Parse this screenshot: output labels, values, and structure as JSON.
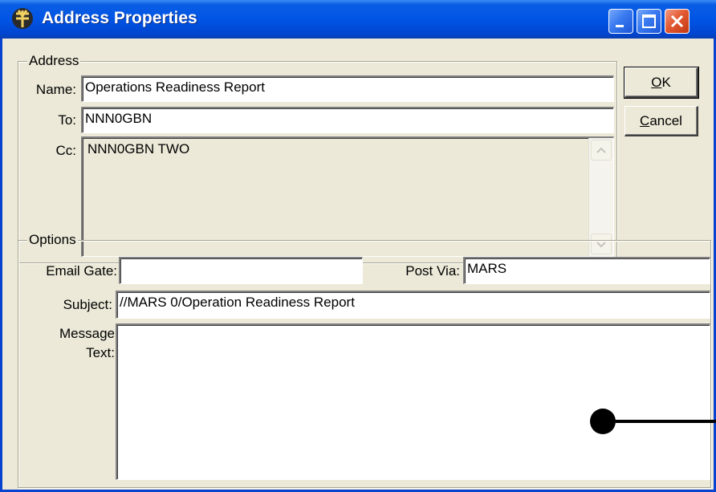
{
  "window": {
    "title": "Address Properties",
    "app_icon": "currency-glyph-icon",
    "controls": [
      "minimize-icon",
      "maximize-icon",
      "close-icon"
    ]
  },
  "address_group": {
    "label": "Address",
    "name_label": "Name:",
    "name_value": "Operations Readiness Report",
    "to_label": "To:",
    "to_value": "NNN0GBN",
    "cc_label": "Cc:",
    "cc_value": "NNN0GBN TWO"
  },
  "buttons": {
    "ok_prefix": "",
    "ok_mnemonic": "O",
    "ok_rest": "K",
    "cancel_mnemonic": "C",
    "cancel_rest": "ancel"
  },
  "options_group": {
    "label": "Options",
    "email_gate_label": "Email Gate:",
    "email_gate_value": "",
    "post_via_label": "Post Via:",
    "post_via_value": "MARS",
    "subject_label": "Subject:",
    "subject_value": "//MARS 0/Operation Readiness Report",
    "message_label_line1": "Message",
    "message_label_line2": "Text:",
    "message_value": ""
  },
  "colors": {
    "titlebar": "#0055e5",
    "window_face": "#ece9d8",
    "close_button": "#e35a32"
  }
}
